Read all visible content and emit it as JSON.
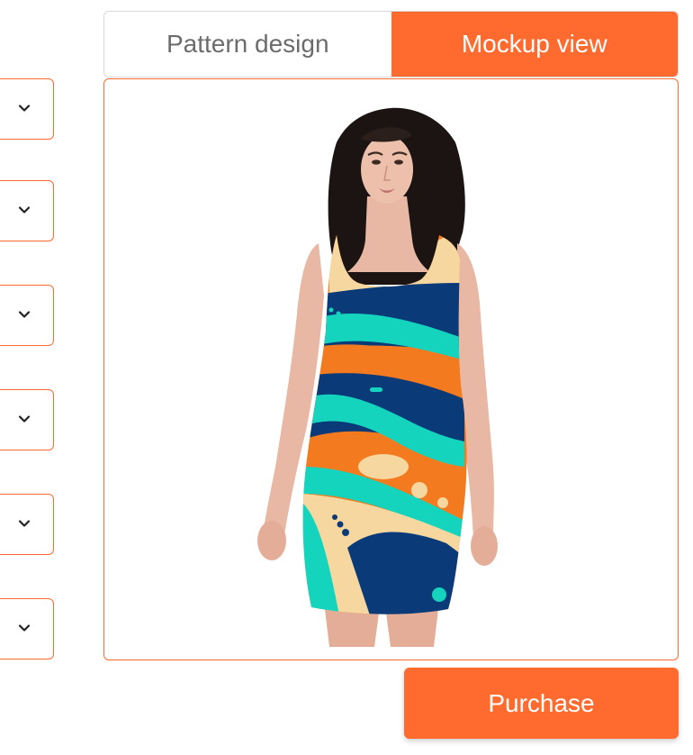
{
  "tabs": {
    "pattern_design": "Pattern design",
    "mockup_view": "Mockup view",
    "active": "mockup_view"
  },
  "dropdowns": [
    {
      "icon": "chevron-down-icon"
    },
    {
      "icon": "chevron-down-icon"
    },
    {
      "icon": "chevron-down-icon"
    },
    {
      "icon": "chevron-down-icon"
    },
    {
      "icon": "chevron-down-icon"
    },
    {
      "icon": "chevron-down-icon"
    }
  ],
  "actions": {
    "purchase_label": "Purchase"
  },
  "colors": {
    "accent": "#ff6a2e",
    "pattern_orange": "#f47a1f",
    "pattern_teal": "#14d4bd",
    "pattern_navy": "#0b3a78",
    "pattern_cream": "#f6d7a0"
  }
}
